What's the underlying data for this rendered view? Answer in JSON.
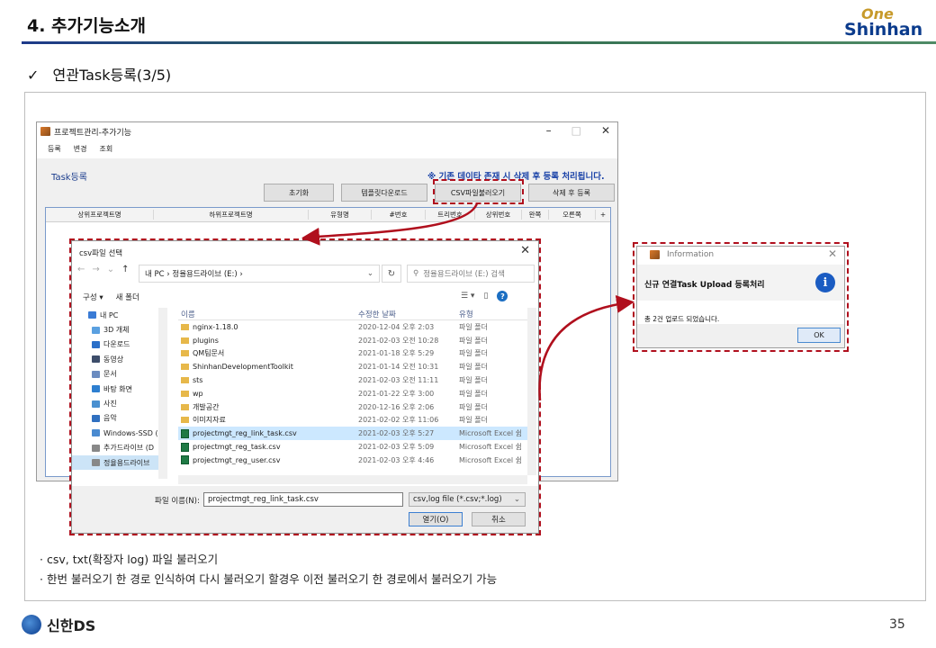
{
  "slide": {
    "title": "4. 추가기능소개",
    "brand_top": "One",
    "brand_bottom": "Shinhan",
    "subtitle_check": "✓",
    "subtitle": "연관Task등록(3/5)",
    "footer_brand": "신한DS",
    "page_number": "35",
    "bullets": [
      "csv, txt(확장자 log) 파일 불러오기",
      "한번 불러오기 한 경로 인식하여 다시 불러오기 할경우 이전 불러오기 한 경로에서 불러오기 가능"
    ]
  },
  "main_window": {
    "title": "프로젝트관리-추가기능",
    "menu": [
      "등록",
      "변경",
      "조회"
    ],
    "section_label": "Task등록",
    "notice": "※ 기존 데이타 존재 시 삭제 후 등록 처리됩니다.",
    "buttons": [
      "초기화",
      "템플릿다운로드",
      "CSV파일불러오기",
      "삭제 후 등록"
    ],
    "grid_columns": [
      "상위프로젝트명",
      "하위프로젝트명",
      "유형명",
      "#번호",
      "트리번호",
      "상위번호",
      "완쪽",
      "오른쪽"
    ]
  },
  "file_dialog": {
    "title": "csv파일 선택",
    "address": "내 PC  ›  정율용드라이브 (E:)  ›",
    "search_placeholder": "정율용드라이브 (E:) 검색",
    "toolbar": [
      "구성 ▾",
      "새 폴더"
    ],
    "nav_items": [
      {
        "label": "내 PC",
        "icon": "pc-icon",
        "color": "#3a7bd5"
      },
      {
        "label": "3D 개체",
        "icon": "cube-icon",
        "color": "#5aa0e0"
      },
      {
        "label": "다운로드",
        "icon": "download-icon",
        "color": "#2a6fc8"
      },
      {
        "label": "동영상",
        "icon": "video-icon",
        "color": "#3d4d6a"
      },
      {
        "label": "문서",
        "icon": "document-icon",
        "color": "#6b8cc0"
      },
      {
        "label": "바탕 화면",
        "icon": "desktop-icon",
        "color": "#2d7fd0"
      },
      {
        "label": "사진",
        "icon": "picture-icon",
        "color": "#4a90d0"
      },
      {
        "label": "음악",
        "icon": "music-icon",
        "color": "#3070c0"
      },
      {
        "label": "Windows-SSD (C",
        "icon": "drive-icon",
        "color": "#4a8ad0"
      },
      {
        "label": "추가드라이브 (D",
        "icon": "drive-icon",
        "color": "#888888"
      },
      {
        "label": "정율용드라이브",
        "icon": "drive-icon",
        "color": "#888888"
      }
    ],
    "columns": [
      "이름",
      "수정한 날짜",
      "유형"
    ],
    "files": [
      {
        "name": "nginx-1.18.0",
        "date": "2020-12-04 오후 2:03",
        "type": "파일 폴더",
        "kind": "folder"
      },
      {
        "name": "plugins",
        "date": "2021-02-03 오전 10:28",
        "type": "파일 폴더",
        "kind": "folder"
      },
      {
        "name": "QM팀문서",
        "date": "2021-01-18 오후 5:29",
        "type": "파일 폴더",
        "kind": "folder"
      },
      {
        "name": "ShinhanDevelopmentToolkit",
        "date": "2021-01-14 오전 10:31",
        "type": "파일 폴더",
        "kind": "folder"
      },
      {
        "name": "sts",
        "date": "2021-02-03 오전 11:11",
        "type": "파일 폴더",
        "kind": "folder"
      },
      {
        "name": "wp",
        "date": "2021-01-22 오후 3:00",
        "type": "파일 폴더",
        "kind": "folder"
      },
      {
        "name": "개발공간",
        "date": "2020-12-16 오후 2:06",
        "type": "파일 폴더",
        "kind": "folder"
      },
      {
        "name": "이미지자료",
        "date": "2021-02-02 오후 11:06",
        "type": "파일 폴더",
        "kind": "folder"
      },
      {
        "name": "projectmgt_reg_link_task.csv",
        "date": "2021-02-03 오후 5:27",
        "type": "Microsoft Excel 쉼",
        "kind": "excel",
        "selected": true
      },
      {
        "name": "projectmgt_reg_task.csv",
        "date": "2021-02-03 오후 5:09",
        "type": "Microsoft Excel 쉼",
        "kind": "excel"
      },
      {
        "name": "projectmgt_reg_user.csv",
        "date": "2021-02-03 오후 4:46",
        "type": "Microsoft Excel 쉼",
        "kind": "excel"
      }
    ],
    "filename_label": "파일 이름(N):",
    "filename_value": "projectmgt_reg_link_task.csv",
    "filetype": "csv,log file (*.csv;*.log)",
    "open_button": "열기(O)",
    "cancel_button": "취소"
  },
  "info_dialog": {
    "title": "Information",
    "message": "신규 연결Task Upload 등록처리",
    "detail": "총 2건 업로드 되었습니다.",
    "ok_button": "OK"
  },
  "colors": {
    "highlight": "#b00f1d",
    "accent_blue": "#1b43a8",
    "brand_navy": "#0b3b8c",
    "brand_gold": "#c79a2b"
  }
}
